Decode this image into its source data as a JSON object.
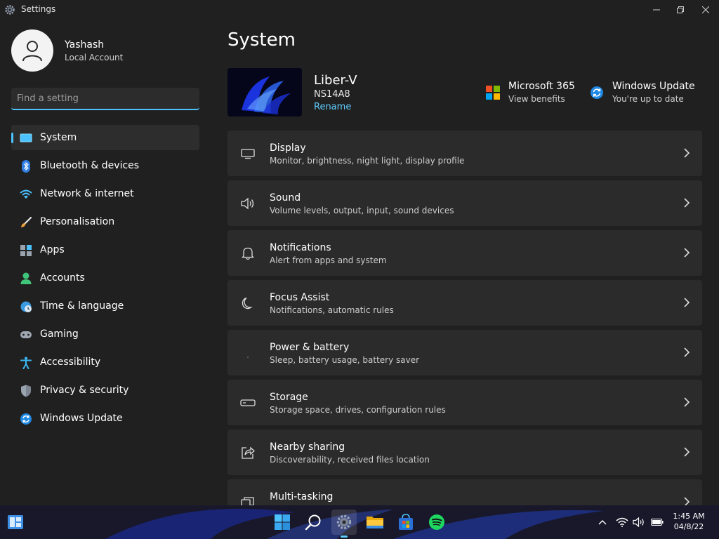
{
  "window": {
    "title": "Settings"
  },
  "colors": {
    "accent": "#4cc2ff",
    "link": "#60cdff",
    "card_bg": "#2b2b2b",
    "window_bg": "#202020"
  },
  "profile": {
    "name": "Yashash",
    "account_type": "Local Account"
  },
  "search": {
    "placeholder": "Find a setting"
  },
  "nav": {
    "items": [
      {
        "label": "System",
        "icon": "monitor-icon",
        "active": true
      },
      {
        "label": "Bluetooth & devices",
        "icon": "bluetooth-icon"
      },
      {
        "label": "Network & internet",
        "icon": "wifi-icon"
      },
      {
        "label": "Personalisation",
        "icon": "brush-icon"
      },
      {
        "label": "Apps",
        "icon": "apps-icon"
      },
      {
        "label": "Accounts",
        "icon": "person-icon"
      },
      {
        "label": "Time & language",
        "icon": "globe-clock-icon"
      },
      {
        "label": "Gaming",
        "icon": "gamepad-icon"
      },
      {
        "label": "Accessibility",
        "icon": "accessibility-icon"
      },
      {
        "label": "Privacy & security",
        "icon": "shield-icon"
      },
      {
        "label": "Windows Update",
        "icon": "update-icon"
      }
    ]
  },
  "main": {
    "title": "System",
    "device": {
      "name": "Liber-V",
      "model": "NS14A8",
      "rename_label": "Rename"
    },
    "quick_links": {
      "microsoft365": {
        "title": "Microsoft 365",
        "subtitle": "View benefits",
        "icon": "microsoft-logo-icon"
      },
      "windows_update": {
        "title": "Windows Update",
        "subtitle": "You're up to date",
        "icon": "update-icon"
      }
    },
    "cards": [
      {
        "title": "Display",
        "subtitle": "Monitor, brightness, night light, display profile",
        "icon": "display-icon"
      },
      {
        "title": "Sound",
        "subtitle": "Volume levels, output, input, sound devices",
        "icon": "speaker-icon"
      },
      {
        "title": "Notifications",
        "subtitle": "Alert from apps and system",
        "icon": "bell-icon"
      },
      {
        "title": "Focus Assist",
        "subtitle": "Notifications, automatic rules",
        "icon": "moon-icon"
      },
      {
        "title": "Power & battery",
        "subtitle": "Sleep, battery usage, battery saver",
        "icon": "power-icon"
      },
      {
        "title": "Storage",
        "subtitle": "Storage space, drives, configuration rules",
        "icon": "storage-icon"
      },
      {
        "title": "Nearby sharing",
        "subtitle": "Discoverability, received files location",
        "icon": "share-icon"
      },
      {
        "title": "Multi-tasking",
        "subtitle": "",
        "icon": "multitask-icon"
      }
    ]
  },
  "taskbar": {
    "apps": [
      "widgets-icon",
      "start-icon",
      "search-icon",
      "settings-icon",
      "file-explorer-icon",
      "store-icon",
      "spotify-icon"
    ],
    "active_app": "settings-icon",
    "time": "1:45 AM",
    "date": "04/8/22"
  }
}
